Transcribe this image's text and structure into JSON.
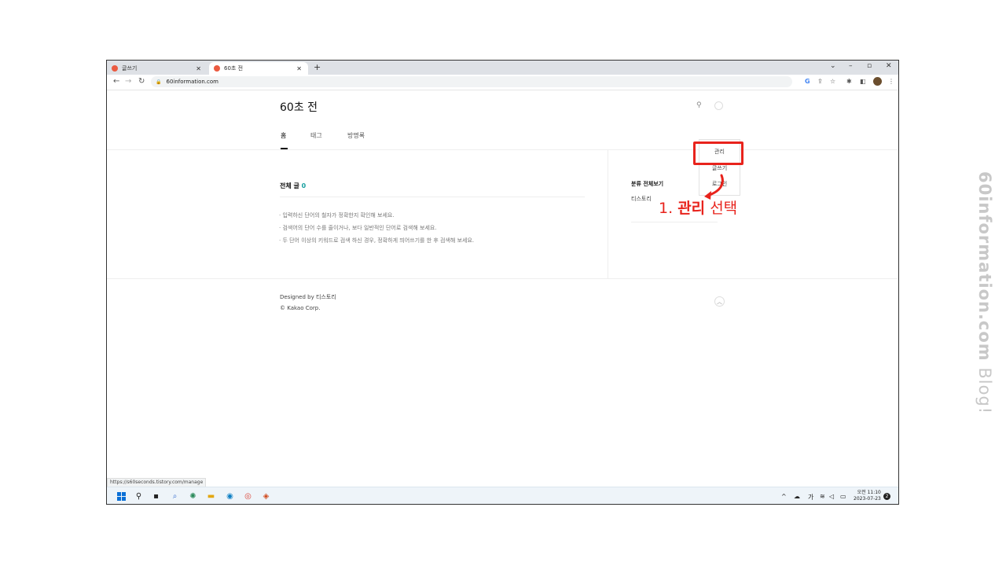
{
  "browser": {
    "tabs": [
      {
        "label": "글쓰기",
        "active": false
      },
      {
        "label": "60초 전",
        "active": true
      }
    ],
    "url": "60information.com",
    "status_url": "https://s60seconds.tistory.com/manage"
  },
  "blog": {
    "title": "60초 전",
    "nav": [
      "홈",
      "태그",
      "방명록"
    ],
    "all_posts_label": "전체 글",
    "all_posts_count": "0",
    "tips": [
      "· 입력하신 단어의 철자가 정확한지 확인해 보세요.",
      "· 검색어의 단어 수를 줄이거나, 보다 일반적인 단어로 검색해 보세요.",
      "· 두 단어 이상의 키워드로 검색 하신 경우, 정확하게 띄어쓰기를 한 후 검색해 보세요."
    ],
    "category_header": "분류 전체보기",
    "category_item": "티스토리",
    "footer_designed": "Designed by 티스토리",
    "footer_copyright": "© Kakao Corp."
  },
  "dropdown": {
    "items": [
      "관리",
      "글쓰기",
      "로그인"
    ]
  },
  "annotation": {
    "step": "1.",
    "keyword": "관리",
    "action": "선택",
    "color": "#e8231c"
  },
  "taskbar": {
    "time": "오전 11:10",
    "date": "2023-07-23",
    "ime": "가"
  },
  "watermark": {
    "site": "60information.com",
    "suffix": "Blog!"
  }
}
